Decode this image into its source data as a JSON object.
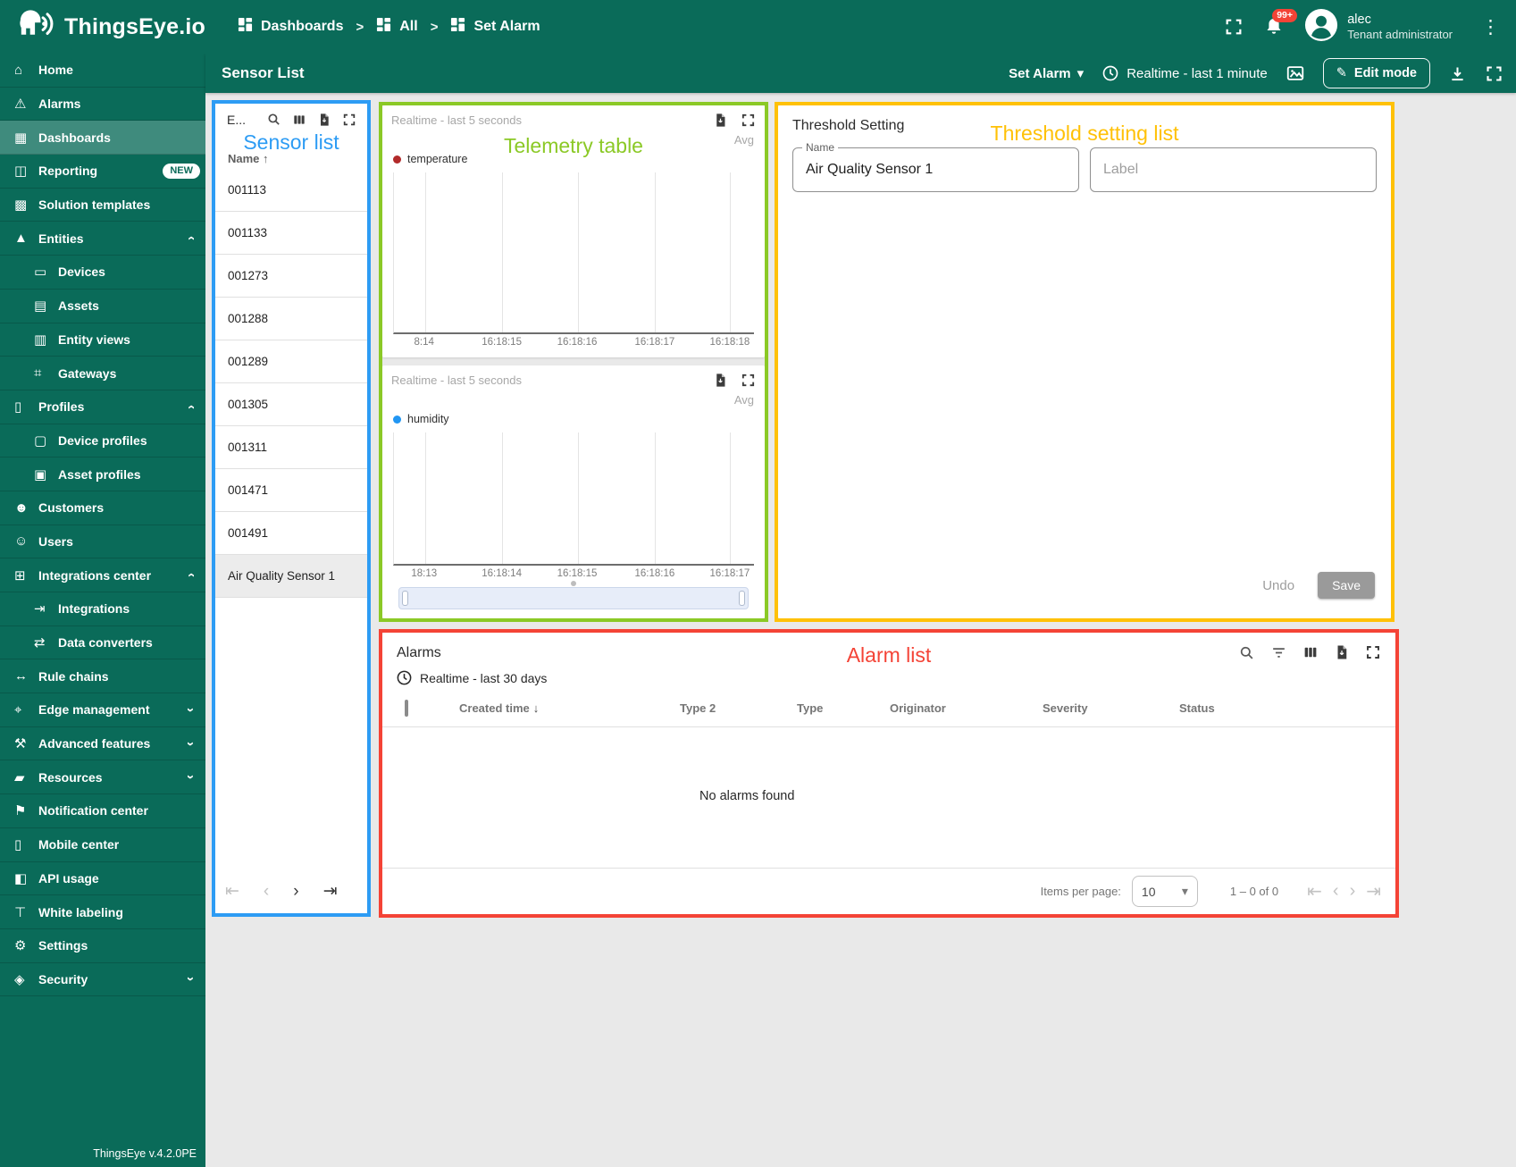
{
  "app": {
    "brand": "ThingsEye.io",
    "version": "ThingsEye v.4.2.0PE"
  },
  "header": {
    "breadcrumbs": [
      {
        "label": "Dashboards"
      },
      {
        "label": "All"
      },
      {
        "label": "Set Alarm"
      }
    ],
    "notification_badge": "99+",
    "user": {
      "name": "alec",
      "role": "Tenant administrator"
    }
  },
  "toolbar": {
    "title": "Sensor List",
    "state_button": "Set Alarm",
    "timewindow": "Realtime - last 1 minute",
    "edit_button": "Edit mode"
  },
  "icons": {
    "first_page": "⇤",
    "prev_page": "‹",
    "next_page": "›",
    "last_page": "⇥",
    "caret_down": "▾",
    "kebab": "⋮",
    "pencil": "✎",
    "sort_asc": "↑",
    "sort_desc": "↓",
    "breadcrumb_sep": ">"
  },
  "sidebar": {
    "items": [
      {
        "label": "Home",
        "icon": "home-icon",
        "glyph": "⌂"
      },
      {
        "label": "Alarms",
        "icon": "alarm-warning-icon",
        "glyph": "⚠"
      },
      {
        "label": "Dashboards",
        "icon": "dashboards-icon",
        "glyph": "▦",
        "selected": true
      },
      {
        "label": "Reporting",
        "icon": "reporting-icon",
        "glyph": "◫",
        "badge": "NEW"
      },
      {
        "label": "Solution templates",
        "icon": "solution-templates-icon",
        "glyph": "▩"
      },
      {
        "label": "Entities",
        "icon": "entities-icon",
        "glyph": "▲",
        "chevron": "up"
      },
      {
        "label": "Devices",
        "icon": "devices-icon",
        "glyph": "▭",
        "indent": true
      },
      {
        "label": "Assets",
        "icon": "assets-icon",
        "glyph": "▤",
        "indent": true
      },
      {
        "label": "Entity views",
        "icon": "entity-views-icon",
        "glyph": "▥",
        "indent": true
      },
      {
        "label": "Gateways",
        "icon": "gateways-icon",
        "glyph": "⌗",
        "indent": true
      },
      {
        "label": "Profiles",
        "icon": "profiles-icon",
        "glyph": "▯",
        "chevron": "up"
      },
      {
        "label": "Device profiles",
        "icon": "device-profiles-icon",
        "glyph": "▢",
        "indent": true
      },
      {
        "label": "Asset profiles",
        "icon": "asset-profiles-icon",
        "glyph": "▣",
        "indent": true
      },
      {
        "label": "Customers",
        "icon": "customers-icon",
        "glyph": "☻"
      },
      {
        "label": "Users",
        "icon": "users-icon",
        "glyph": "☺"
      },
      {
        "label": "Integrations center",
        "icon": "integrations-center-icon",
        "glyph": "⊞",
        "chevron": "up"
      },
      {
        "label": "Integrations",
        "icon": "integrations-icon",
        "glyph": "⇥",
        "indent": true
      },
      {
        "label": "Data converters",
        "icon": "data-converters-icon",
        "glyph": "⇄",
        "indent": true
      },
      {
        "label": "Rule chains",
        "icon": "rule-chains-icon",
        "glyph": "↔"
      },
      {
        "label": "Edge management",
        "icon": "edge-management-icon",
        "glyph": "⌖",
        "chevron": "down"
      },
      {
        "label": "Advanced features",
        "icon": "advanced-features-icon",
        "glyph": "⚒",
        "chevron": "down"
      },
      {
        "label": "Resources",
        "icon": "resources-icon",
        "glyph": "▰",
        "chevron": "down"
      },
      {
        "label": "Notification center",
        "icon": "notification-center-icon",
        "glyph": "⚑"
      },
      {
        "label": "Mobile center",
        "icon": "mobile-center-icon",
        "glyph": "▯"
      },
      {
        "label": "API usage",
        "icon": "api-usage-icon",
        "glyph": "◧"
      },
      {
        "label": "White labeling",
        "icon": "white-labeling-icon",
        "glyph": "⊤"
      },
      {
        "label": "Settings",
        "icon": "settings-icon",
        "glyph": "⚙"
      },
      {
        "label": "Security",
        "icon": "security-icon",
        "glyph": "◈",
        "chevron": "down"
      }
    ]
  },
  "annotations": {
    "sensor_list": {
      "label": "Sensor list",
      "color": "#2D9CF4"
    },
    "telemetry": {
      "label": "Telemetry table",
      "color": "#8BC926"
    },
    "threshold": {
      "label": "Threshold setting list",
      "color": "#FFC107"
    },
    "alarm": {
      "label": "Alarm list",
      "color": "#F44336"
    }
  },
  "sensor_list": {
    "title": "E...",
    "column_header": "Name",
    "rows": [
      "001113",
      "001133",
      "001273",
      "001288",
      "001289",
      "001305",
      "001311",
      "001471",
      "001491",
      "Air Quality Sensor 1"
    ],
    "selected_row": "Air Quality Sensor 1"
  },
  "charts": [
    {
      "timewindow": "Realtime - last 5 seconds",
      "aggregation": "Avg",
      "series": "temperature",
      "series_color": "#B22A2A",
      "x_ticks": [
        "8:14",
        "16:18:15",
        "16:18:16",
        "16:18:17",
        "16:18:18"
      ]
    },
    {
      "timewindow": "Realtime - last 5 seconds",
      "aggregation": "Avg",
      "series": "humidity",
      "series_color": "#2196F3",
      "x_ticks": [
        "18:13",
        "16:18:14",
        "16:18:15",
        "16:18:16",
        "16:18:17"
      ]
    }
  ],
  "threshold": {
    "title": "Threshold Setting",
    "name_label": "Name",
    "name_value": "Air Quality Sensor 1",
    "label_placeholder": "Label",
    "undo_button": "Undo",
    "save_button": "Save"
  },
  "alarms": {
    "title": "Alarms",
    "timewindow": "Realtime - last 30 days",
    "columns": [
      "Created time",
      "Type 2",
      "Type",
      "Originator",
      "Severity",
      "Status"
    ],
    "sort_column": "Created time",
    "empty_message": "No alarms found",
    "items_per_page_label": "Items per page:",
    "items_per_page": "10",
    "range_label": "1 – 0 of 0"
  }
}
